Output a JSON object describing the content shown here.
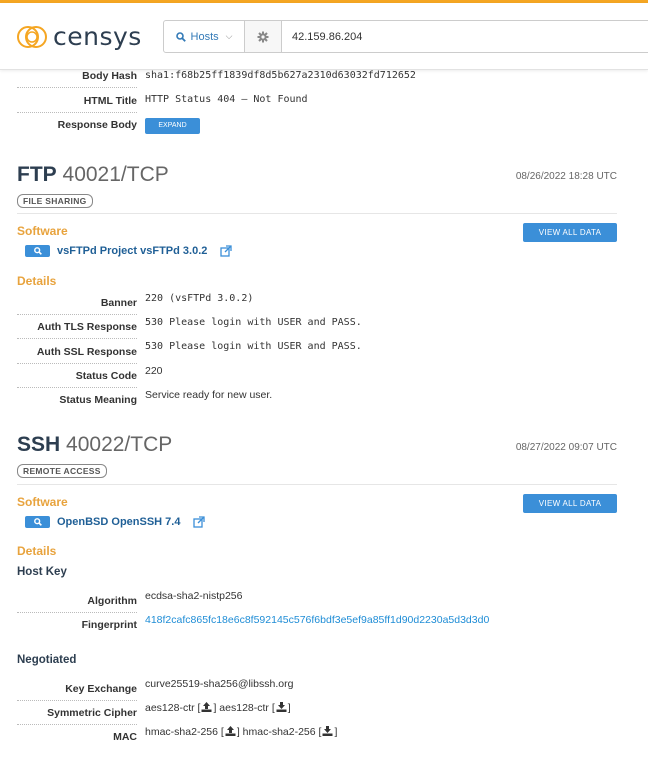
{
  "header": {
    "logo_text": "censys",
    "search_type": "Hosts",
    "query": "42.159.86.204"
  },
  "http_tail": {
    "rows": [
      {
        "label": "Body Hash",
        "value": "sha1:f68b25ff1839df8d5b627a2310d63032fd712652"
      },
      {
        "label": "HTML Title",
        "value": "HTTP Status 404 – Not Found"
      },
      {
        "label": "Response Body",
        "button": "EXPAND"
      }
    ]
  },
  "ftp": {
    "protocol": "FTP",
    "port": "40021/TCP",
    "date": "08/26/2022 18:28 UTC",
    "tag": "FILE SHARING",
    "software_heading": "Software",
    "view_all": "VIEW ALL DATA",
    "software": "vsFTPd Project vsFTPd 3.0.2",
    "details_heading": "Details",
    "details": [
      {
        "label": "Banner",
        "value": "220 (vsFTPd 3.0.2)"
      },
      {
        "label": "Auth TLS Response",
        "value": "530 Please login with USER and PASS."
      },
      {
        "label": "Auth SSL Response",
        "value": "530 Please login with USER and PASS."
      },
      {
        "label": "Status Code",
        "value": "220"
      },
      {
        "label": "Status Meaning",
        "value": "Service ready for new user."
      }
    ]
  },
  "ssh": {
    "protocol": "SSH",
    "port": "40022/TCP",
    "date": "08/27/2022 09:07 UTC",
    "tag": "REMOTE ACCESS",
    "software_heading": "Software",
    "view_all": "VIEW ALL DATA",
    "software": "OpenBSD OpenSSH 7.4",
    "details_heading": "Details",
    "host_key_heading": "Host Key",
    "host_key": [
      {
        "label": "Algorithm",
        "value": "ecdsa-sha2-nistp256"
      },
      {
        "label": "Fingerprint",
        "value": "418f2cafc865fc18e6c8f592145c576f6bdf3e5ef9a85ff1d90d2230a5d3d3d0"
      }
    ],
    "negotiated_heading": "Negotiated",
    "negotiated": {
      "kex_label": "Key Exchange",
      "kex_value": "curve25519-sha256@libssh.org",
      "cipher_label": "Symmetric Cipher",
      "cipher_a": "aes128-ctr",
      "cipher_b": "aes128-ctr",
      "mac_label": "MAC",
      "mac_a": "hmac-sha2-256",
      "mac_b": "hmac-sha2-256"
    }
  }
}
